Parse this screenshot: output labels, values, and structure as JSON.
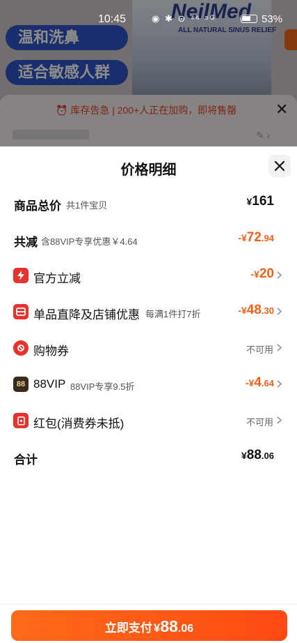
{
  "status_bar": {
    "time": "10:45",
    "icons": "◉ ✱ ⊙ ⁴⁶ ⁵ᴳ",
    "battery": "53%"
  },
  "background": {
    "pill1": "温和洗鼻",
    "pill2": "适合敏感人群",
    "brand": "NeilMed",
    "brand_sub": "ALL NATURAL SINUS RELIEF"
  },
  "stock_banner": {
    "text": "⏰ 库存告急 | 200+人正在加购，即将售罄"
  },
  "sheet": {
    "title": "价格明细",
    "rows": {
      "total": {
        "label": "商品总价",
        "sub": "共1件宝贝",
        "cur": "¥",
        "int": "161",
        "dec": ""
      },
      "discount": {
        "label": "共减",
        "sub": "含88VIP专享优惠￥4.64",
        "cur": "-¥",
        "int": "72",
        "dec": ".94"
      },
      "official": {
        "label": "官方立减",
        "cur": "-¥",
        "int": "20",
        "dec": ""
      },
      "store": {
        "label": "单品直降及店铺优惠",
        "sub": "每满1件打7折",
        "cur": "-¥",
        "int": "48",
        "dec": ".30"
      },
      "coupon": {
        "label": "购物券",
        "status": "不可用"
      },
      "vip": {
        "label": "88VIP",
        "sub": "88VIP专享9.5折",
        "icon_text": "88",
        "cur": "-¥",
        "int": "4",
        "dec": ".64"
      },
      "redpacket": {
        "label": "红包(消费券未抵)",
        "status": "不可用"
      },
      "sum": {
        "label": "合计",
        "cur": "¥",
        "int": "88",
        "dec": ".06"
      }
    }
  },
  "pay": {
    "label": "立即支付",
    "cur": "¥",
    "int": "88",
    "dec": ".06"
  },
  "colors": {
    "accent": "#f0621c",
    "button": "#ff5516",
    "official_icon": "#e8322e",
    "store_icon": "#e8322e",
    "coupon_icon": "#e8322e",
    "vip_icon": "#3a2b1c",
    "redpacket_icon": "#e8322e"
  }
}
